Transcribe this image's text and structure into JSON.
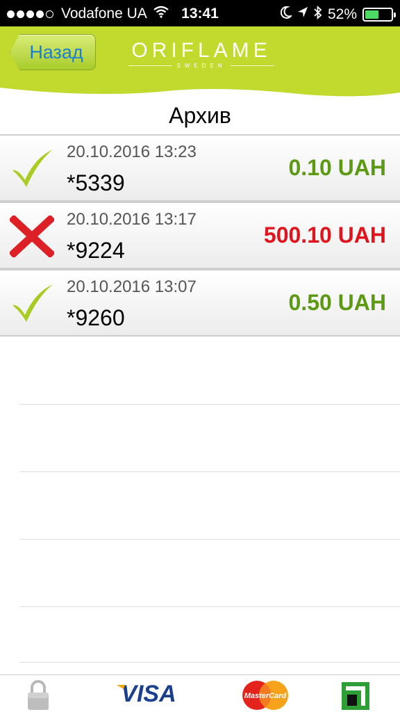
{
  "status_bar": {
    "carrier": "Vodafone UA",
    "time": "13:41",
    "battery_percent": "52%",
    "battery_level": 0.52,
    "signal_bars": 4,
    "icons": [
      "wifi-icon",
      "moon-icon",
      "location-arrow-icon",
      "bluetooth-icon"
    ]
  },
  "header": {
    "back_label": "Назад",
    "brand": "ORIFLAME",
    "brand_sub": "SWEDEN",
    "bg_color": "#c2d92e"
  },
  "title": "Архив",
  "colors": {
    "success": "#5b9a12",
    "error": "#e0141c",
    "check": "#a8cc22",
    "cross": "#dd1f26",
    "back_text": "#1a7fcf"
  },
  "transactions": [
    {
      "date": "20.10.2016 13:23",
      "card": "*5339",
      "amount": "0.10 UAH",
      "status": "success",
      "icon": "check-icon"
    },
    {
      "date": "20.10.2016 13:17",
      "card": "*9224",
      "amount": "500.10 UAH",
      "status": "error",
      "icon": "cross-icon"
    },
    {
      "date": "20.10.2016 13:07",
      "card": "*9260",
      "amount": "0.50 UAH",
      "status": "success",
      "icon": "check-icon"
    }
  ],
  "bottom_bar": {
    "items": [
      {
        "icon": "lock-icon"
      },
      {
        "label": "VISA",
        "icon": "visa-logo"
      },
      {
        "label": "MasterCard",
        "icon": "mastercard-logo"
      },
      {
        "icon": "privatbank-logo"
      }
    ]
  }
}
